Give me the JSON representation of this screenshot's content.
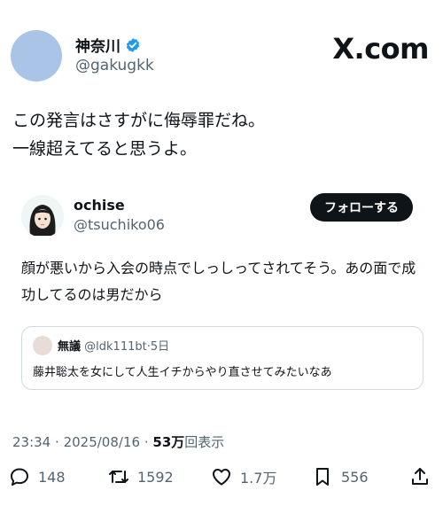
{
  "author": {
    "name": "神奈川",
    "handle": "@gakugkk"
  },
  "brand": "X.com",
  "tweet": {
    "lines": [
      "この発言はさすがに侮辱罪だね。",
      "一線超えてると思うよ。"
    ]
  },
  "quoted": {
    "name": "ochise",
    "handle": "@tsuchiko06",
    "follow_label": "フォローする",
    "lines": [
      "顔が悪いから入会の時点でしっしってされてそう。あの面で成",
      "功してるのは男だから"
    ],
    "nested": {
      "name": "無議",
      "handle": "@ldk111bt",
      "sep": "·",
      "time": "5日",
      "text": "藤井聡太を女にして人生イチからやり直させてみたいなあ"
    }
  },
  "meta": {
    "time": "23:34",
    "sep1": "·",
    "date": "2025/08/16",
    "sep2": "·",
    "views_count": "53万",
    "views_label": "回表示"
  },
  "actions": {
    "replies": "148",
    "reposts": "1592",
    "likes": "1.7万",
    "bookmarks": "556"
  },
  "colors": {
    "verified": "#1d9bf0",
    "muted": "#536471",
    "text": "#0f1419"
  }
}
